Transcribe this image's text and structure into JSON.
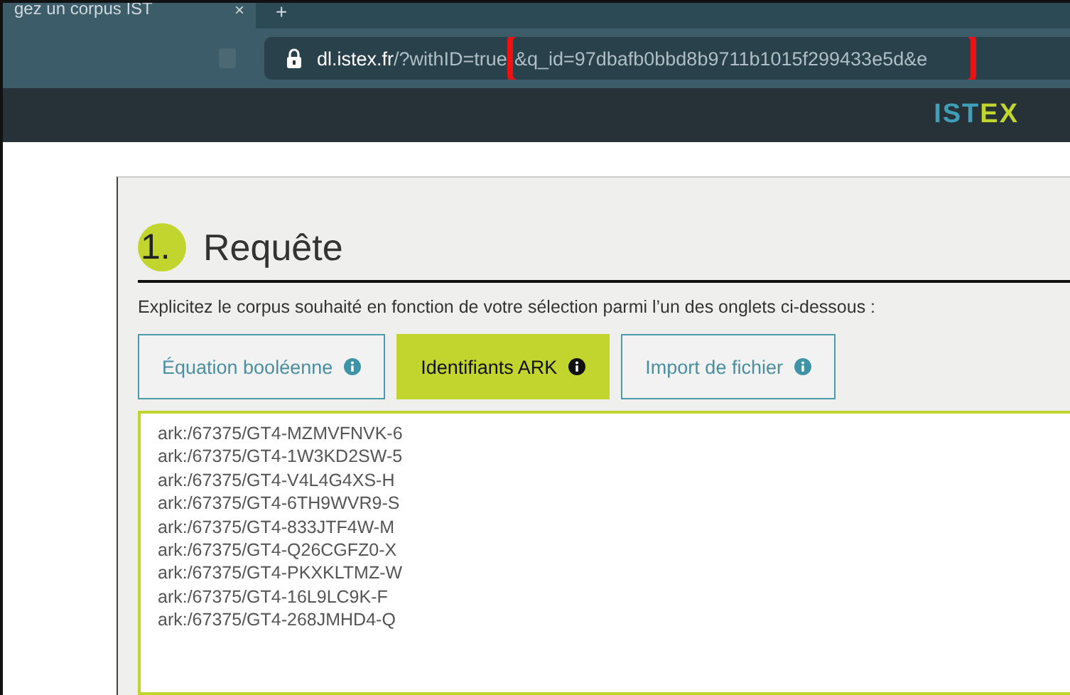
{
  "browser": {
    "tab_title": "gez un corpus IST",
    "tab_close": "×",
    "new_tab": "+",
    "address": {
      "host": "dl.istex.fr",
      "path": "/?withID=true",
      "highlighted_part": "&q_id=97dbafb0bbd8b9711b1015f299433e5d&e"
    },
    "highlight": true
  },
  "header": {
    "logo": [
      "IST",
      "EX"
    ]
  },
  "section": {
    "number": "1.",
    "title": "Requête",
    "description": "Explicitez le corpus souhaité en fonction de votre sélection parmi l’un des onglets ci-dessous :"
  },
  "tabs": [
    {
      "label": "Équation booléenne",
      "selected": false
    },
    {
      "label": "Identifiants ARK",
      "selected": true
    },
    {
      "label": "Import de fichier",
      "selected": false
    }
  ],
  "identifiers": [
    "ark:/67375/GT4-MZMVFNVK-6",
    "ark:/67375/GT4-1W3KD2SW-5",
    "ark:/67375/GT4-V4L4G4XS-H",
    "ark:/67375/GT4-6TH9WVR9-S",
    "ark:/67375/GT4-833JTF4W-M",
    "ark:/67375/GT4-Q26CGFZ0-X",
    "ark:/67375/GT4-PKXKLTMZ-W",
    "ark:/67375/GT4-16L9LC9K-F",
    "ark:/67375/GT4-268JMHD4-Q"
  ]
}
